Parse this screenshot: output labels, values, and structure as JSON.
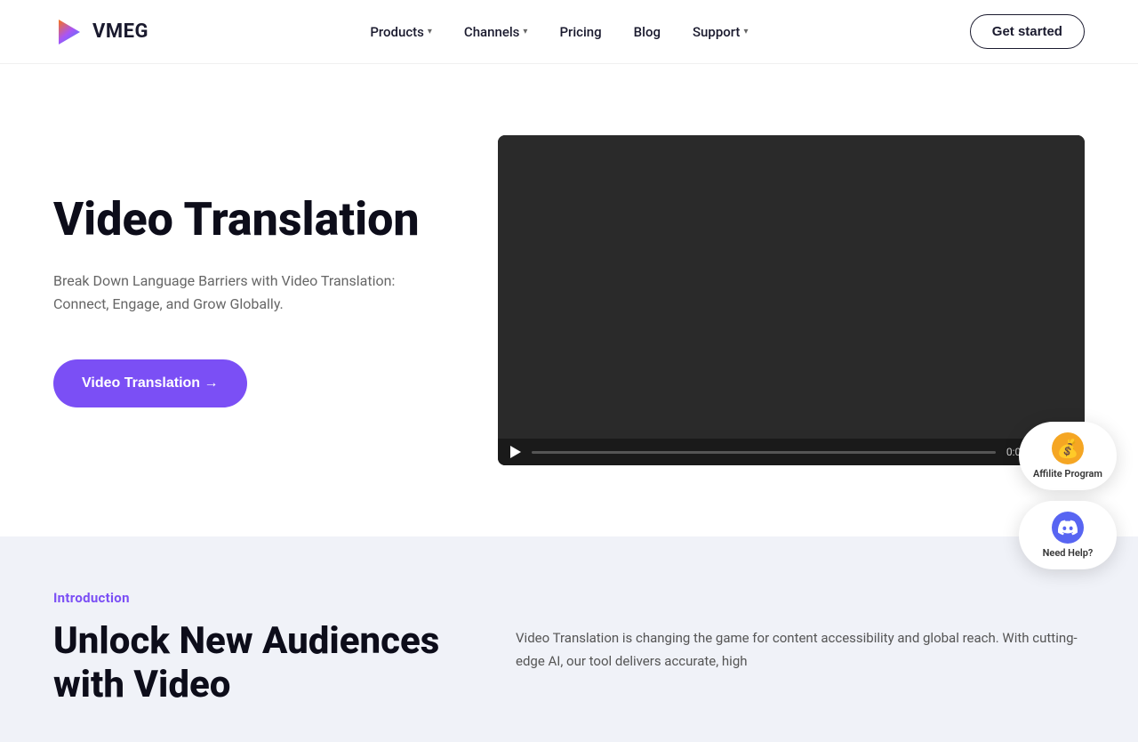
{
  "brand": {
    "name": "VMEG"
  },
  "nav": {
    "links": [
      {
        "label": "Products",
        "hasDropdown": true
      },
      {
        "label": "Channels",
        "hasDropdown": true
      },
      {
        "label": "Pricing",
        "hasDropdown": false
      },
      {
        "label": "Blog",
        "hasDropdown": false
      },
      {
        "label": "Support",
        "hasDropdown": true
      }
    ],
    "cta": "Get started"
  },
  "hero": {
    "title": "Video Translation",
    "description": "Break Down Language Barriers with Video Translation: Connect, Engage, and Grow Globally.",
    "cta": "Video Translation →",
    "video": {
      "time": "0:00"
    }
  },
  "widgets": {
    "affiliate": {
      "label": "Affilite Program"
    },
    "discord": {
      "label": "Need Help?"
    }
  },
  "intro": {
    "section_label": "Introduction",
    "headline": "Unlock New Audiences with Video",
    "body": "Video Translation is changing the game for content accessibility and global reach. With cutting-edge AI, our tool delivers accurate, high"
  }
}
